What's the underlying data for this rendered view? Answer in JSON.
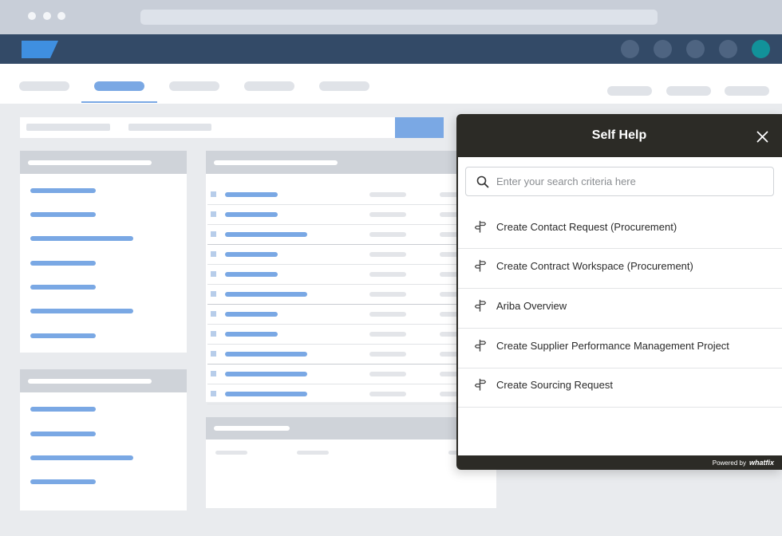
{
  "colors": {
    "header_bg": "#334a67",
    "accent_blue": "#7aa8e4",
    "panel_dark": "#2c2b26",
    "avatar_teal": "#12929a"
  },
  "self_help": {
    "title": "Self Help",
    "close_icon": "close-icon",
    "search_placeholder": "Enter your search criteria here",
    "items": [
      {
        "label": "Create Contact Request (Procurement)",
        "icon": "signpost-icon"
      },
      {
        "label": "Create Contract Workspace (Procurement)",
        "icon": "signpost-icon"
      },
      {
        "label": "Ariba Overview",
        "icon": "signpost-icon"
      },
      {
        "label": "Create Supplier Performance Management Project",
        "icon": "signpost-icon"
      },
      {
        "label": "Create Sourcing Request",
        "icon": "signpost-icon"
      }
    ],
    "footer_prefix": "Powered by",
    "footer_brand": "whatfix"
  }
}
